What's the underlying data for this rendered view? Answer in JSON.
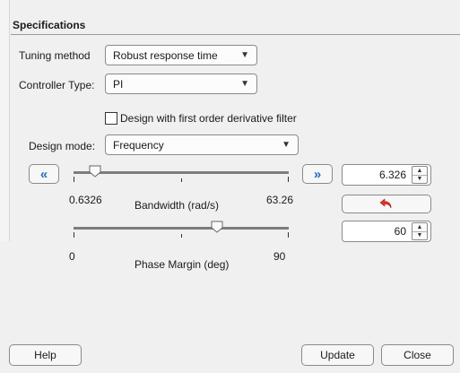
{
  "specifications": {
    "title": "Specifications"
  },
  "tuning_method": {
    "label": "Tuning method",
    "value": "Robust response time"
  },
  "controller_type": {
    "label": "Controller Type:",
    "value": "PI"
  },
  "derivative_filter": {
    "label": "Design with first order derivative filter",
    "checked": false
  },
  "design_mode": {
    "label": "Design mode:",
    "value": "Frequency"
  },
  "bandwidth": {
    "label": "Bandwidth (rad/s)",
    "min_label": "0.6326",
    "max_label": "63.26",
    "value": "6.326",
    "slider_fraction": 0.1,
    "decrease_label": "«",
    "increase_label": "»"
  },
  "phase_margin": {
    "label": "Phase Margin (deg)",
    "min_label": "0",
    "max_label": "90",
    "value": "60",
    "slider_fraction": 0.6667
  },
  "spinner": {
    "up_arrow": "▲",
    "down_arrow": "▼"
  },
  "dropdown_arrow": "▼",
  "icons": {
    "reset": "undo-arrow-icon",
    "reset_color": "#e0312b"
  },
  "buttons": {
    "help": "Help",
    "update": "Update",
    "close": "Close"
  }
}
